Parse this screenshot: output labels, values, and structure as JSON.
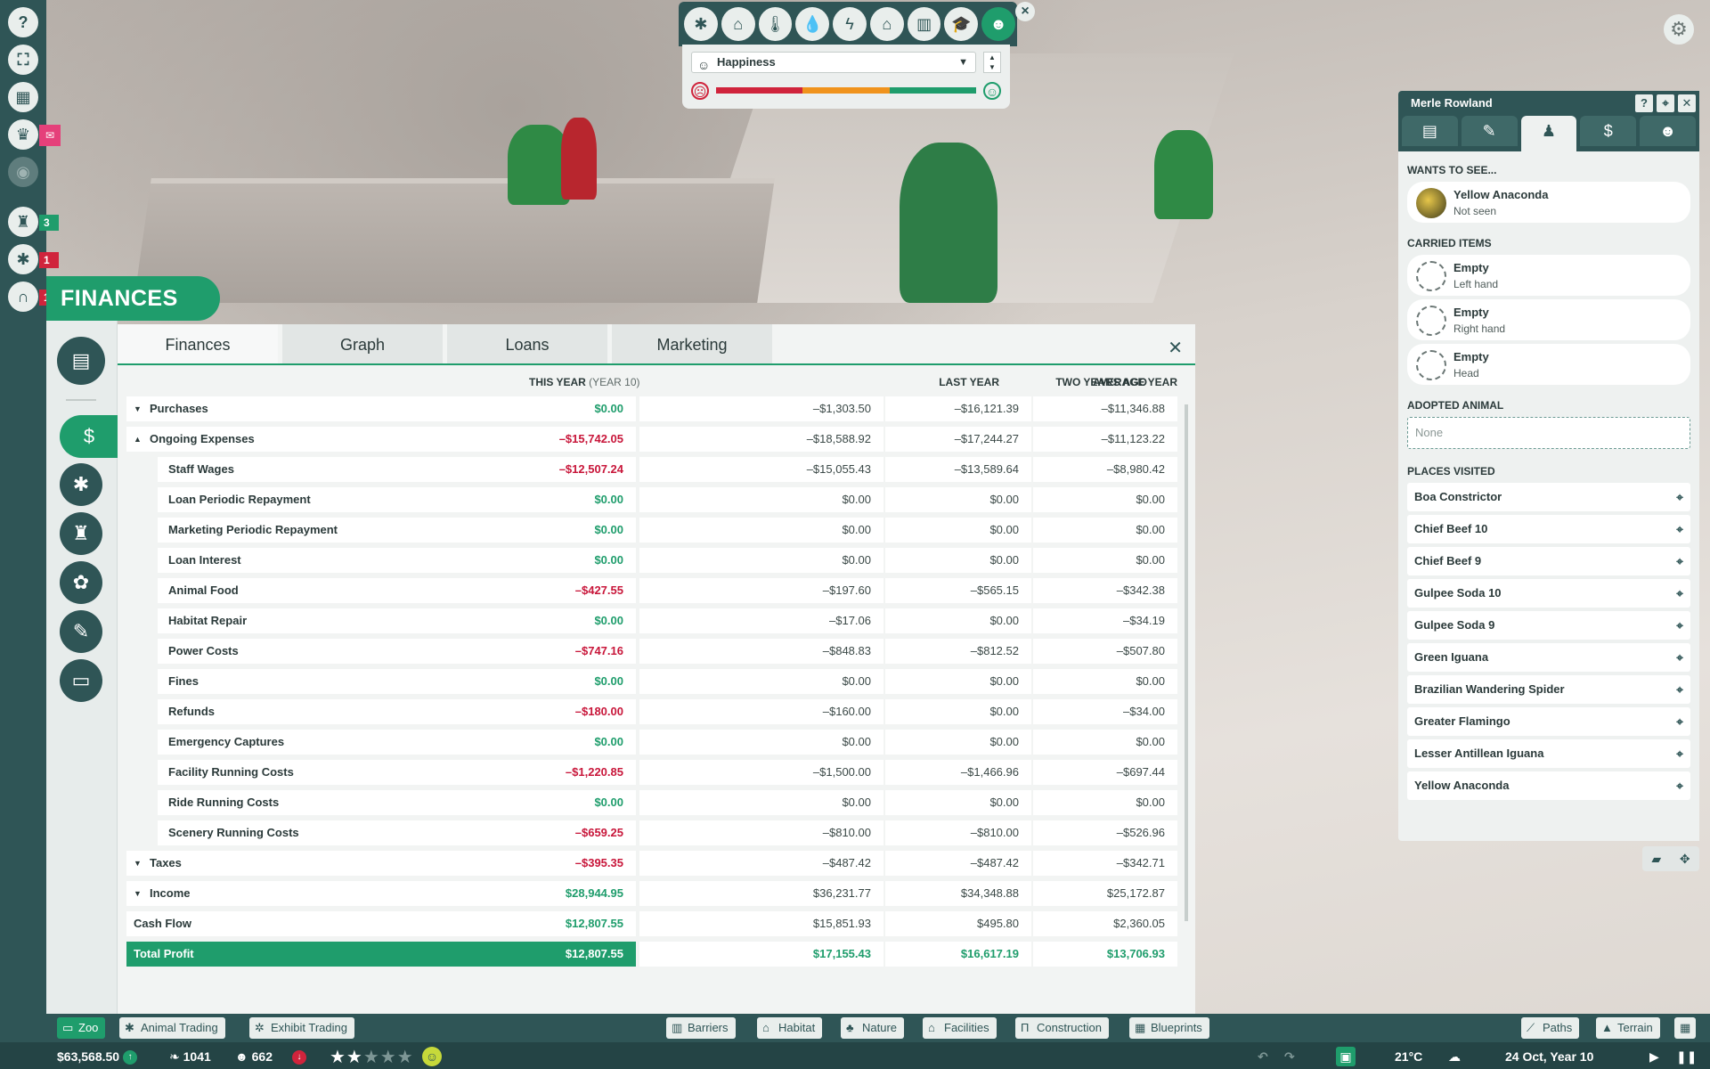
{
  "window": {
    "panel_title": "FINANCES"
  },
  "colors": {
    "accent": "#1f9d6c",
    "dark": "#2f5556",
    "negative": "#c8163a"
  },
  "left_rail": {
    "icons": [
      "help-icon",
      "zoo-icon",
      "calendar-icon",
      "trophy-icon",
      "eye-icon",
      "keeper-icon",
      "paw-icon",
      "gate-icon"
    ],
    "badges": {
      "keeper": "3",
      "paw": "1",
      "gate": "1"
    }
  },
  "overlay": {
    "icons": [
      "paw-icon",
      "habitat-icon",
      "temperature-icon",
      "water-icon",
      "power-icon",
      "building-icon",
      "facility-icon",
      "education-icon",
      "guests-icon"
    ],
    "selected": "Happiness"
  },
  "tabs": [
    "Finances",
    "Graph",
    "Loans",
    "Marketing"
  ],
  "columns": {
    "this_year": "THIS YEAR",
    "this_year_sub": "(YEAR 10)",
    "last_year": "LAST YEAR",
    "two_years": "TWO YEARS AGO",
    "average": "AVERAGE YEAR"
  },
  "rows": [
    {
      "name": "Purchases",
      "this": "$0.00",
      "last": "–$1,303.50",
      "two": "–$16,121.39",
      "avg": "–$11,346.88"
    },
    {
      "name": "Ongoing Expenses",
      "this": "–$15,742.05",
      "last": "–$18,588.92",
      "two": "–$17,244.27",
      "avg": "–$11,123.22"
    },
    {
      "name": "Staff Wages",
      "this": "–$12,507.24",
      "last": "–$15,055.43",
      "two": "–$13,589.64",
      "avg": "–$8,980.42"
    },
    {
      "name": "Loan Periodic Repayment",
      "this": "$0.00",
      "last": "$0.00",
      "two": "$0.00",
      "avg": "$0.00"
    },
    {
      "name": "Marketing Periodic Repayment",
      "this": "$0.00",
      "last": "$0.00",
      "two": "$0.00",
      "avg": "$0.00"
    },
    {
      "name": "Loan Interest",
      "this": "$0.00",
      "last": "$0.00",
      "two": "$0.00",
      "avg": "$0.00"
    },
    {
      "name": "Animal Food",
      "this": "–$427.55",
      "last": "–$197.60",
      "two": "–$565.15",
      "avg": "–$342.38"
    },
    {
      "name": "Habitat Repair",
      "this": "$0.00",
      "last": "–$17.06",
      "two": "$0.00",
      "avg": "–$34.19"
    },
    {
      "name": "Power Costs",
      "this": "–$747.16",
      "last": "–$848.83",
      "two": "–$812.52",
      "avg": "–$507.80"
    },
    {
      "name": "Fines",
      "this": "$0.00",
      "last": "$0.00",
      "two": "$0.00",
      "avg": "$0.00"
    },
    {
      "name": "Refunds",
      "this": "–$180.00",
      "last": "–$160.00",
      "two": "$0.00",
      "avg": "–$34.00"
    },
    {
      "name": "Emergency Captures",
      "this": "$0.00",
      "last": "$0.00",
      "two": "$0.00",
      "avg": "$0.00"
    },
    {
      "name": "Facility Running Costs",
      "this": "–$1,220.85",
      "last": "–$1,500.00",
      "two": "–$1,466.96",
      "avg": "–$697.44"
    },
    {
      "name": "Ride Running Costs",
      "this": "$0.00",
      "last": "$0.00",
      "two": "$0.00",
      "avg": "$0.00"
    },
    {
      "name": "Scenery Running Costs",
      "this": "–$659.25",
      "last": "–$810.00",
      "two": "–$810.00",
      "avg": "–$526.96"
    },
    {
      "name": "Taxes",
      "this": "–$395.35",
      "last": "–$487.42",
      "two": "–$487.42",
      "avg": "–$342.71"
    },
    {
      "name": "Income",
      "this": "$28,944.95",
      "last": "$36,231.77",
      "two": "$34,348.88",
      "avg": "$25,172.87"
    },
    {
      "name": "Cash Flow",
      "this": "$12,807.55",
      "last": "$15,851.93",
      "two": "$495.80",
      "avg": "$2,360.05"
    },
    {
      "name": "Total Profit",
      "this": "$12,807.55",
      "last": "$17,155.43",
      "two": "$16,617.19",
      "avg": "$13,706.93"
    }
  ],
  "guest": {
    "name": "Merle Rowland",
    "wants_label": "WANTS TO SEE...",
    "wants": {
      "title": "Yellow Anaconda",
      "status": "Not seen"
    },
    "carried_label": "CARRIED ITEMS",
    "carried": [
      {
        "title": "Empty",
        "slot": "Left hand"
      },
      {
        "title": "Empty",
        "slot": "Right hand"
      },
      {
        "title": "Empty",
        "slot": "Head"
      }
    ],
    "adopted_label": "ADOPTED ANIMAL",
    "adopted_value": "None",
    "places_label": "PLACES VISITED",
    "places": [
      "Boa Constrictor",
      "Chief Beef 10",
      "Chief Beef 9",
      "Gulpee Soda 10",
      "Gulpee Soda 9",
      "Green Iguana",
      "Brazilian Wandering Spider",
      "Greater Flamingo",
      "Lesser Antillean Iguana",
      "Yellow Anaconda"
    ]
  },
  "bottom": {
    "left_buttons": [
      "Zoo",
      "Animal Trading",
      "Exhibit Trading"
    ],
    "center_buttons": [
      "Barriers",
      "Habitat",
      "Nature",
      "Facilities",
      "Construction",
      "Blueprints"
    ],
    "right_buttons": [
      "Paths",
      "Terrain"
    ],
    "money": "$63,568.50",
    "conservation": "1041",
    "guests": "662",
    "rating": 2.5,
    "temperature": "21°C",
    "date": "24 Oct, Year 10"
  }
}
